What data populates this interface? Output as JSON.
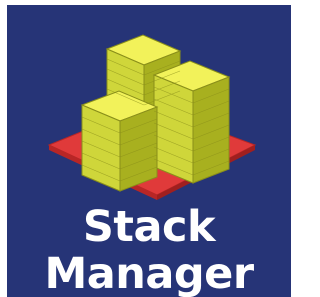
{
  "app": {
    "name_line_1": "Stack",
    "name_line_2": "Manager",
    "logo_icon": "stacked-paper-blocks-icon"
  },
  "colors": {
    "tile_background": "#263477",
    "outer_background": "#ffffff",
    "base_plate": "#e03a3a",
    "block_top": "#f2f25a",
    "block_side": "#b8c22a",
    "text": "#ffffff"
  }
}
